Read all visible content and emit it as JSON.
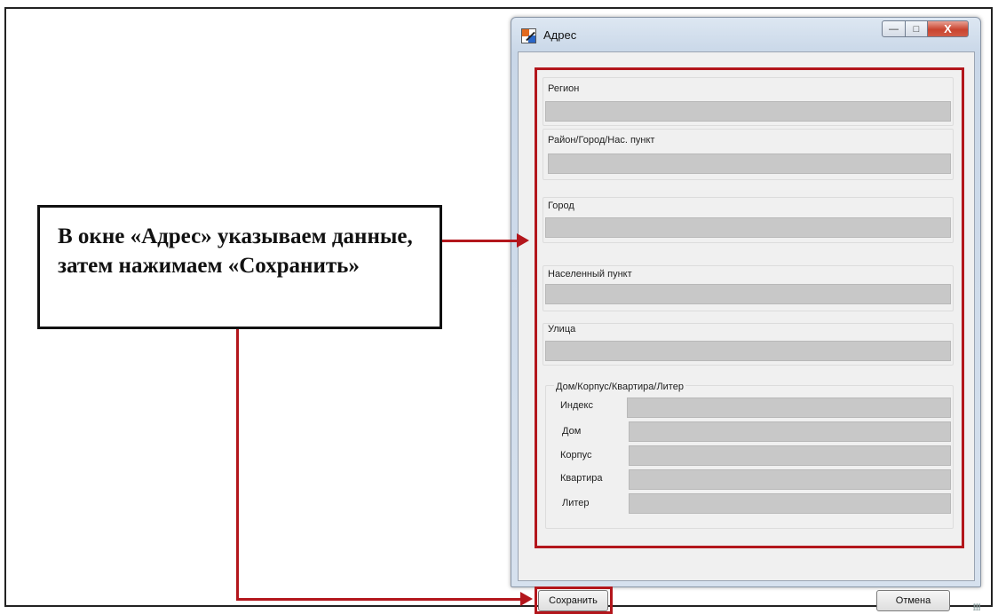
{
  "window": {
    "title": "Адрес",
    "controls": {
      "minimize": "—",
      "maximize": "□",
      "close": "X"
    }
  },
  "form": {
    "region_label": "Регион",
    "district_label": "Район/Город/Нас. пункт",
    "city_label": "Город",
    "settlement_label": "Населенный пункт",
    "street_label": "Улица",
    "house_group_label": "Дом/Корпус/Квартира/Литер",
    "index_label": "Индекс",
    "house_label": "Дом",
    "building_label": "Корпус",
    "apartment_label": "Квартира",
    "letter_label": "Литер"
  },
  "buttons": {
    "save": "Сохранить",
    "cancel": "Отмена"
  },
  "callout": {
    "text": "В окне «Адрес» указываем данные, затем нажимаем «Сохранить»"
  },
  "colors": {
    "highlight": "#b3161c",
    "field": "#c8c8c8"
  }
}
